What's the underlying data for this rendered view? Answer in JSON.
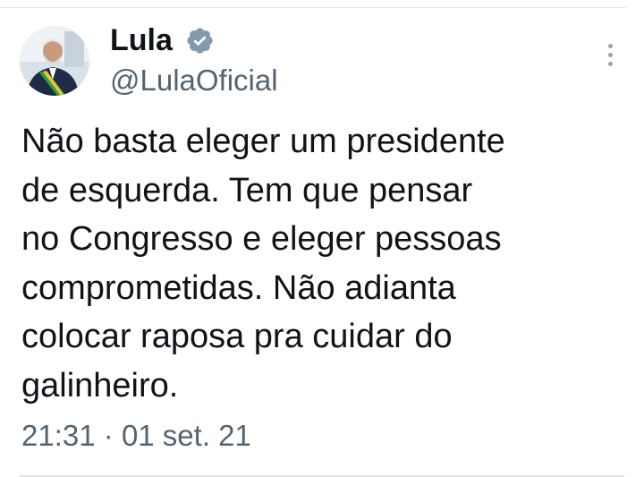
{
  "author": {
    "display_name": "Lula",
    "handle": "@LulaOficial",
    "verified": true,
    "avatar_icon": "profile-photo"
  },
  "tweet": {
    "text_lines": [
      "Não basta eleger um presidente",
      "de esquerda. Tem que pensar",
      "no Congresso e eleger pessoas",
      "comprometidas. Não adianta",
      "colocar raposa pra cuidar do",
      "galinheiro."
    ],
    "time": "21:31",
    "separator": "·",
    "date": "01 set. 21"
  },
  "icons": {
    "verified": "verified-badge-icon",
    "more": "more-options-icon"
  },
  "colors": {
    "text": "#0f1419",
    "secondary": "#536471",
    "badge": "#829aab"
  }
}
